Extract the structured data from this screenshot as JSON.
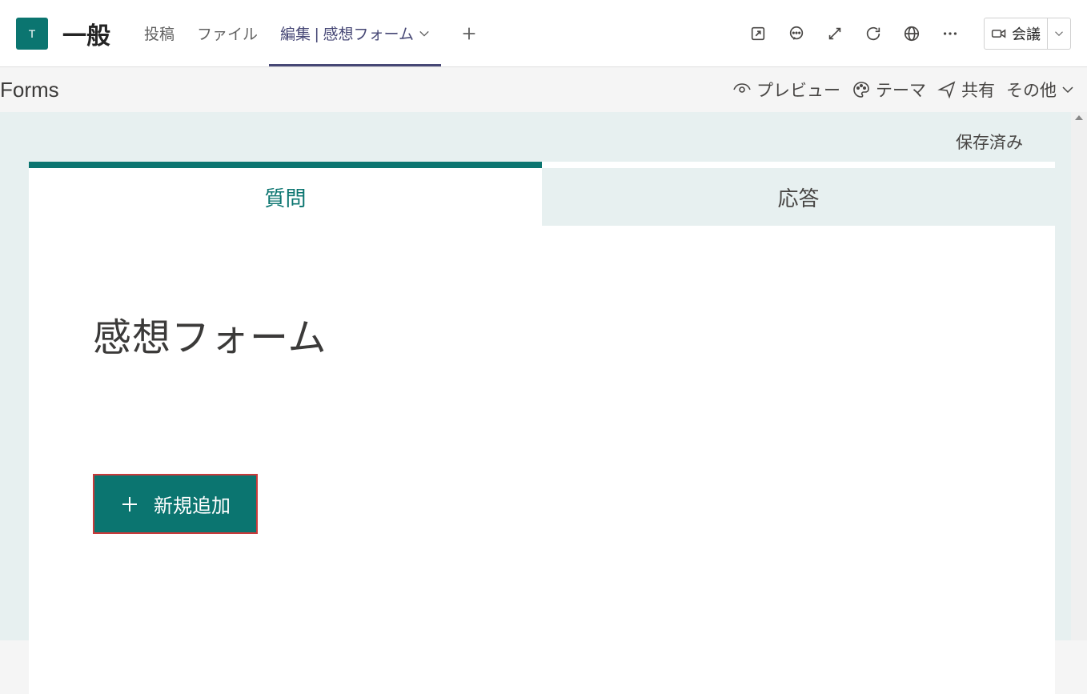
{
  "header": {
    "team_avatar_letter": "T",
    "channel_name": "一般",
    "tabs": [
      {
        "label": "投稿"
      },
      {
        "label": "ファイル"
      },
      {
        "label": "編集 | 感想フォーム"
      }
    ],
    "meet_label": "会議"
  },
  "forms_bar": {
    "app_name": "Forms",
    "preview": "プレビュー",
    "theme": "テーマ",
    "share": "共有",
    "other": "その他"
  },
  "content": {
    "saved_status": "保存済み",
    "form_tabs": {
      "questions": "質問",
      "responses": "応答"
    },
    "form_title": "感想フォーム",
    "add_new_label": "新規追加"
  }
}
